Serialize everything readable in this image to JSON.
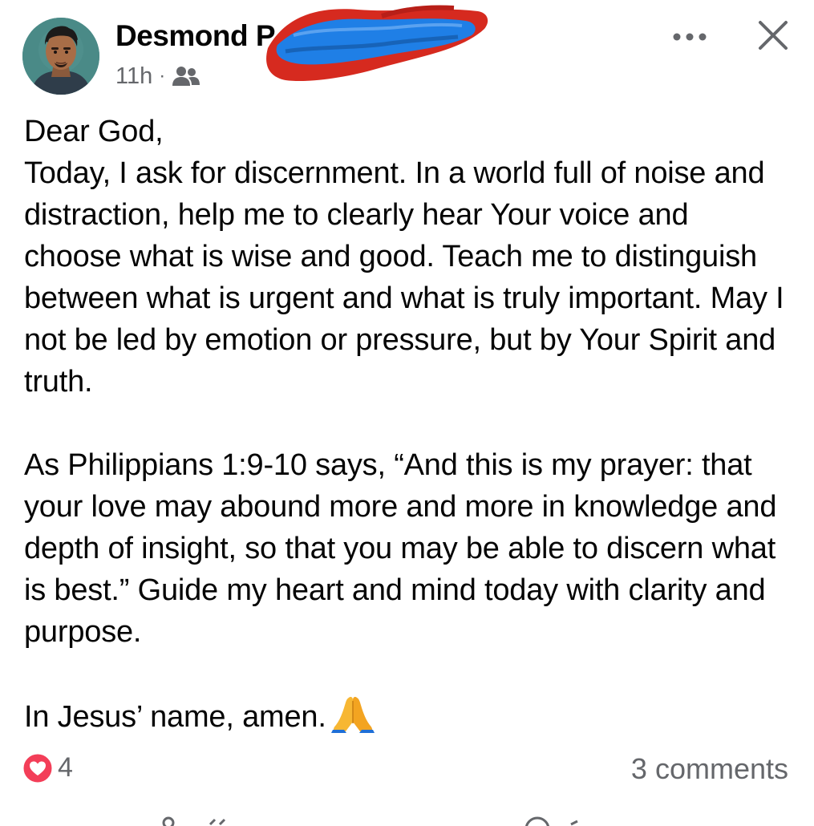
{
  "post": {
    "author": {
      "name": "Desmond P",
      "avatar_icon": "profile-photo"
    },
    "meta": {
      "time": "11h",
      "separator": "·",
      "audience_icon": "friends-icon"
    },
    "header_actions": {
      "more_icon": "more-horizontal-icon",
      "close_icon": "close-icon"
    },
    "body": {
      "greeting": "Dear God,",
      "paragraph_1": "Today, I ask for discernment. In a world full of noise and distraction, help me to clearly hear Your voice and choose what is wise and good. Teach me to distinguish between what is urgent and what is truly important. May I not be led by emotion or pressure, but by Your Spirit and truth.",
      "paragraph_2": "As Philippians 1:9-10 says, “And this is my prayer: that your love may abound more and more in knowledge and depth of insight, so that you may be able to discern what is best.” Guide my heart and mind today with clarity and purpose.",
      "closing": "In Jesus’ name, amen.",
      "closing_emoji": "folded-hands-emoji"
    },
    "engagement": {
      "reaction_icon": "love-reaction-icon",
      "reaction_count": "4",
      "comments": "3 comments"
    }
  },
  "colors": {
    "text_primary": "#050505",
    "text_secondary": "#65676b",
    "love_reaction": "#f33e58",
    "redaction_blue": "#1f7fe6",
    "redaction_red": "#d62a1f"
  }
}
